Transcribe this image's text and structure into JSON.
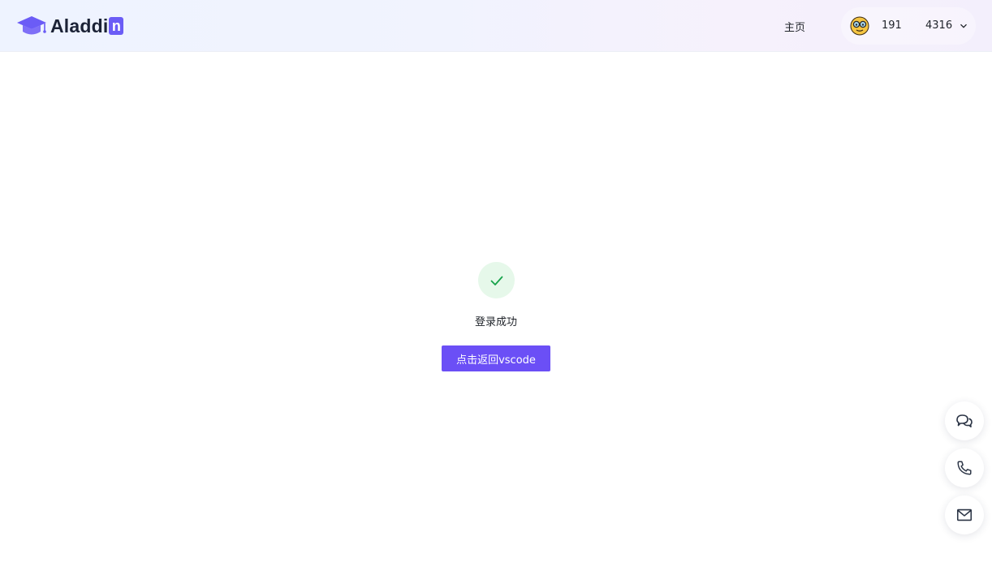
{
  "brand": {
    "name_prefix": "Aladdi",
    "name_last_letter": "n",
    "accent_color": "#6b5cf6"
  },
  "nav": {
    "home_label": "主页"
  },
  "user": {
    "avatar_icon": "emoji-face-glasses-icon",
    "field_a": "191",
    "field_b": "4316",
    "dropdown_icon": "chevron-down-icon"
  },
  "result": {
    "status_icon": "check-icon",
    "status_color": "#16a34a",
    "message": "登录成功",
    "button_label": "点击返回vscode",
    "button_color": "#6b4ff6"
  },
  "floating_actions": [
    {
      "icon": "chat-icon"
    },
    {
      "icon": "phone-icon"
    },
    {
      "icon": "mail-icon"
    }
  ]
}
